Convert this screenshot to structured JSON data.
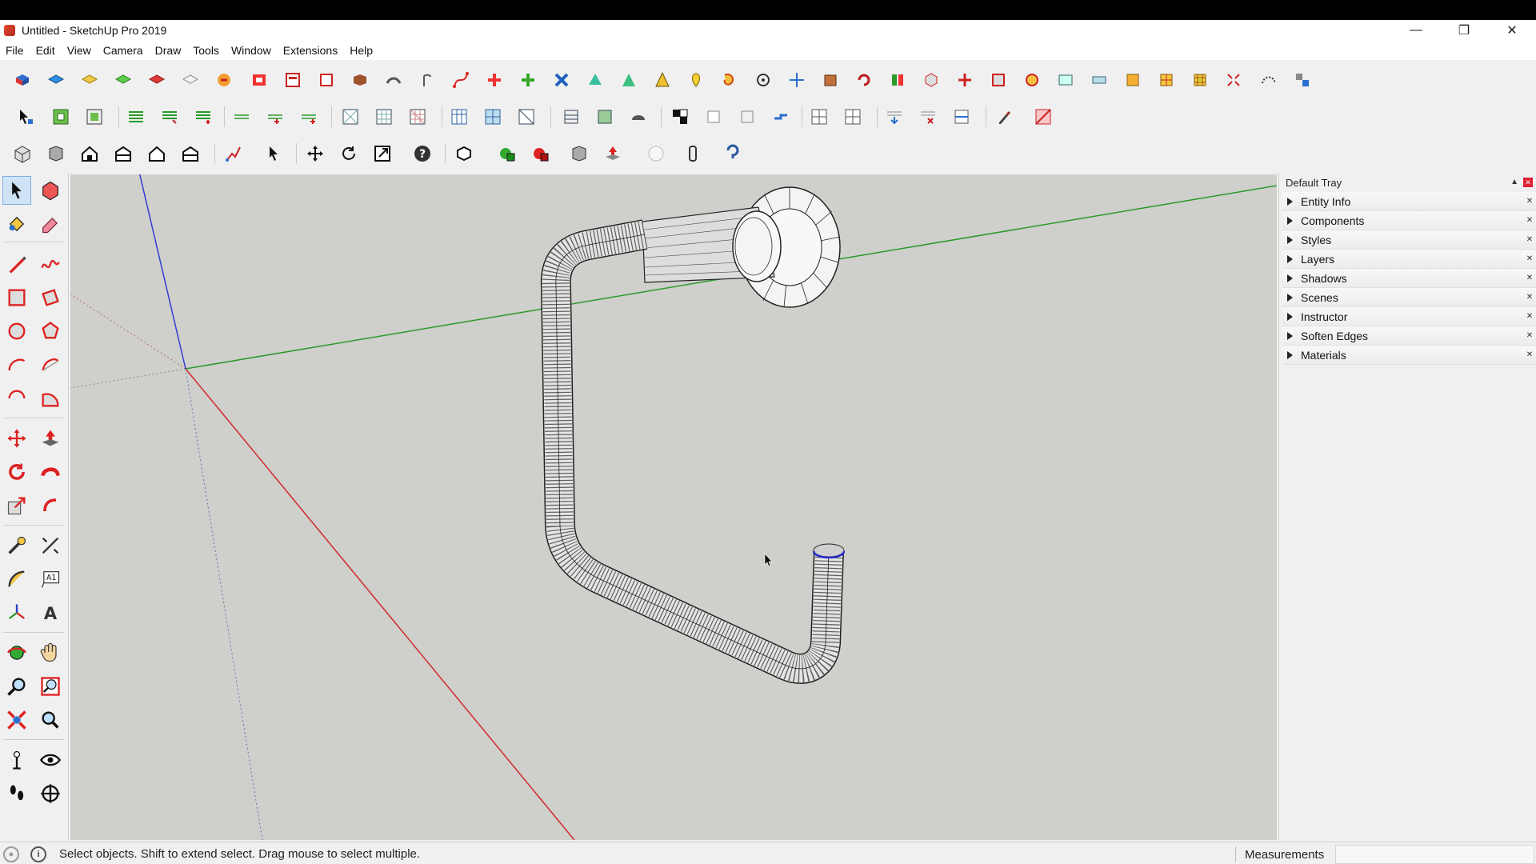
{
  "window": {
    "title": "Untitled - SketchUp Pro 2019",
    "controls": {
      "minimize": "—",
      "restore": "❐",
      "close": "✕"
    }
  },
  "menu": [
    "File",
    "Edit",
    "View",
    "Camera",
    "Draw",
    "Tools",
    "Window",
    "Extensions",
    "Help"
  ],
  "tray": {
    "title": "Default Tray",
    "pin_icon": "pin-icon",
    "close_icon": "close-icon",
    "panels": [
      "Entity Info",
      "Components",
      "Styles",
      "Layers",
      "Shadows",
      "Scenes",
      "Instructor",
      "Soften Edges",
      "Materials"
    ]
  },
  "status": {
    "message": "Select objects. Shift to extend select. Drag mouse to select multiple.",
    "info_icon": "i",
    "measurements_label": "Measurements",
    "measurements_value": ""
  },
  "colors": {
    "viewport_bg": "#cfcfcc",
    "axis_red": "#d0282c",
    "axis_green": "#2a9a2a",
    "axis_blue": "#2f3fd0"
  }
}
